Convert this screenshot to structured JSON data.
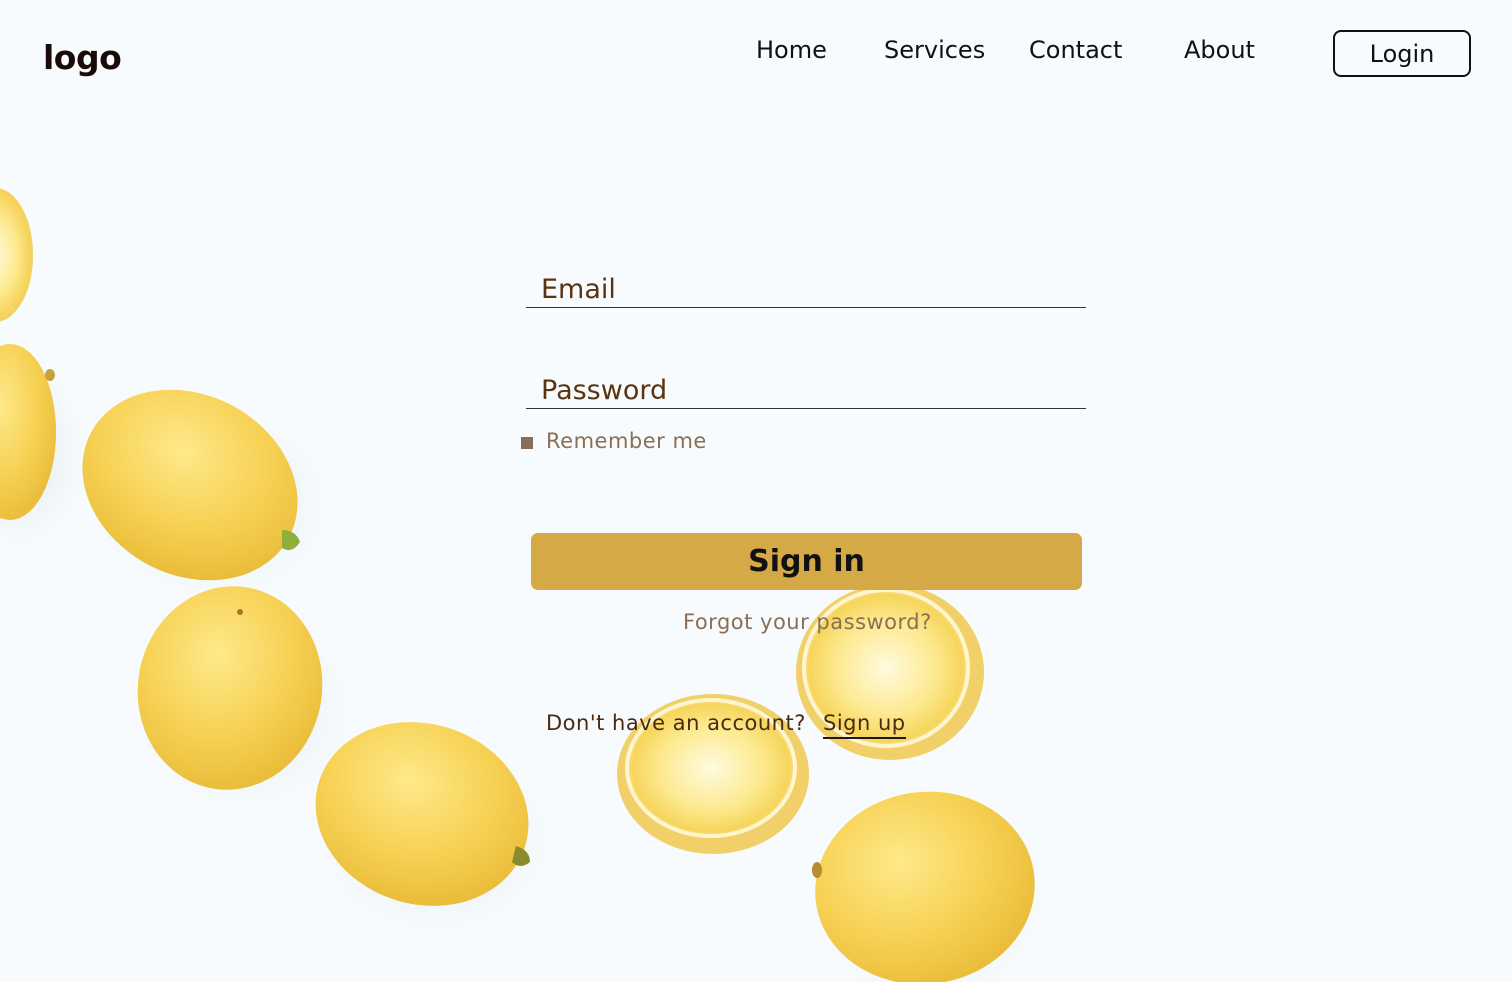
{
  "header": {
    "logo": "logo",
    "nav": [
      "Home",
      "Services",
      "Contact",
      "About"
    ],
    "login_label": "Login"
  },
  "form": {
    "email_label": "Email",
    "password_label": "Password",
    "remember_label": "Remember me",
    "signin_label": "Sign in",
    "forgot_label": "Forgot your password?",
    "no_account_label": "Don't have an account?",
    "signup_label": "Sign up"
  },
  "colors": {
    "background": "#f7fbfd",
    "accent": "#d4a946",
    "label_brown": "#5a3310",
    "muted_brown": "#8a6f55",
    "lemon": "#f4cf4b"
  },
  "background_image": "lemons-on-white"
}
